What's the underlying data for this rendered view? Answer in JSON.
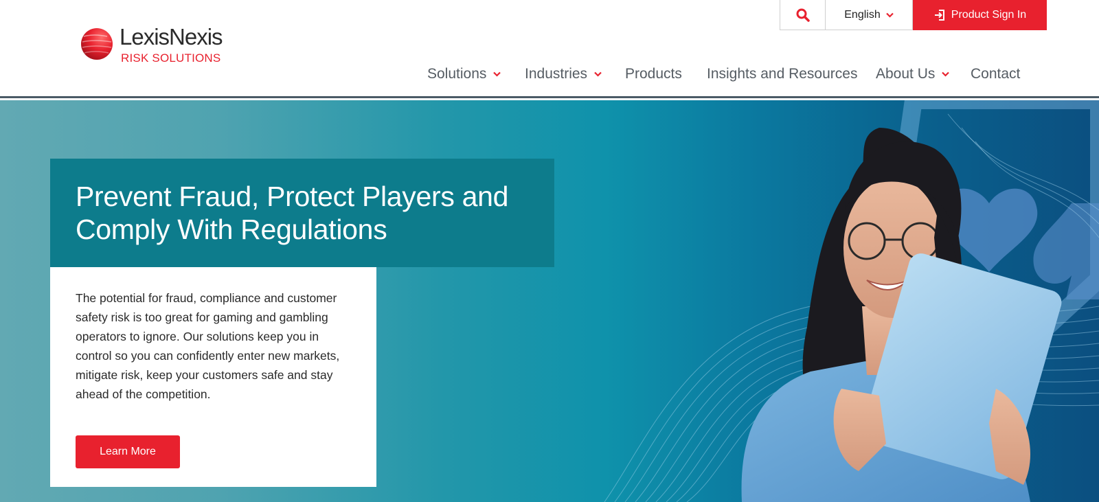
{
  "header": {
    "logo": {
      "name": "LexisNexis",
      "subtitle": "RISK SOLUTIONS"
    },
    "utility": {
      "search_icon": "search-icon",
      "language": "English",
      "sign_in": "Product Sign In"
    },
    "nav": [
      {
        "label": "Solutions",
        "has_dropdown": true
      },
      {
        "label": "Industries",
        "has_dropdown": true
      },
      {
        "label": "Products",
        "has_dropdown": false
      },
      {
        "label": "Insights and Resources",
        "has_dropdown": false
      },
      {
        "label": "About Us",
        "has_dropdown": true
      },
      {
        "label": "Contact",
        "has_dropdown": false
      }
    ]
  },
  "hero": {
    "headline": "Prevent Fraud, Protect Players and Comply With Regulations",
    "body": "The potential for fraud, compliance and customer safety risk is too great for gaming and gambling operators to ignore. Our solutions keep you in control so you can confidently enter new markets, mitigate risk, keep your customers safe and stay ahead of the competition.",
    "cta": "Learn More"
  },
  "colors": {
    "brand_red": "#e8212e",
    "teal_panel": "#0d7c8c",
    "nav_text": "#555c63"
  }
}
